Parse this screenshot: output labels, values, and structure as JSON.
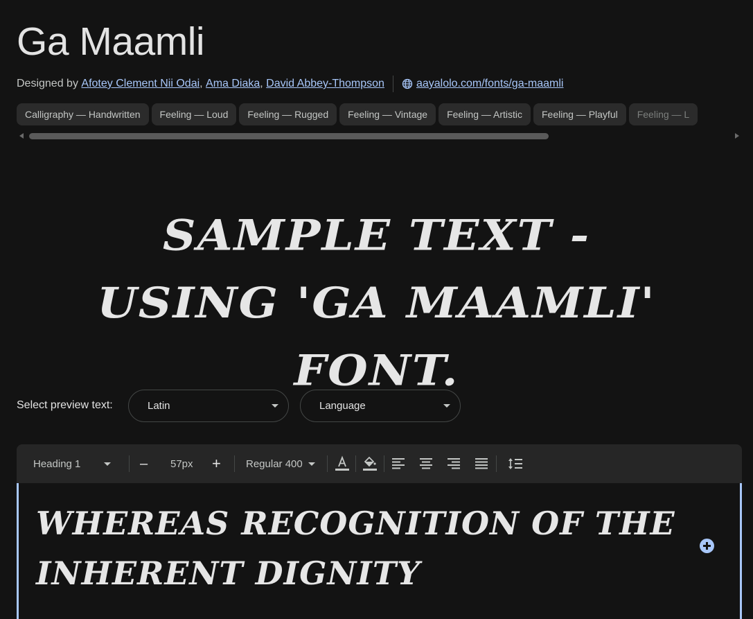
{
  "font": {
    "name": "Ga Maamli",
    "designed_by_label": "Designed by",
    "designers": [
      "Afotey Clement Nii Odai",
      "Ama Diaka",
      "David Abbey-Thompson"
    ],
    "website": "aayalolo.com/fonts/ga-maamli"
  },
  "tags": [
    "Calligraphy — Handwritten",
    "Feeling — Loud",
    "Feeling — Rugged",
    "Feeling — Vintage",
    "Feeling — Artistic",
    "Feeling — Playful",
    "Feeling — L"
  ],
  "sample_text": "Sample text - using 'Ga Maamli' font.",
  "preview": {
    "label": "Select preview text:",
    "script_select": "Latin",
    "language_select": "Language"
  },
  "toolbar": {
    "style": "Heading 1",
    "decrease": "–",
    "size": "57px",
    "increase": "+",
    "weight": "Regular 400"
  },
  "editor": {
    "text": "Whereas recognition of the inherent dignity"
  },
  "colors": {
    "background": "#131313",
    "link": "#a8c7fa",
    "accent": "#a8c7fa",
    "toolbar": "#262626"
  }
}
